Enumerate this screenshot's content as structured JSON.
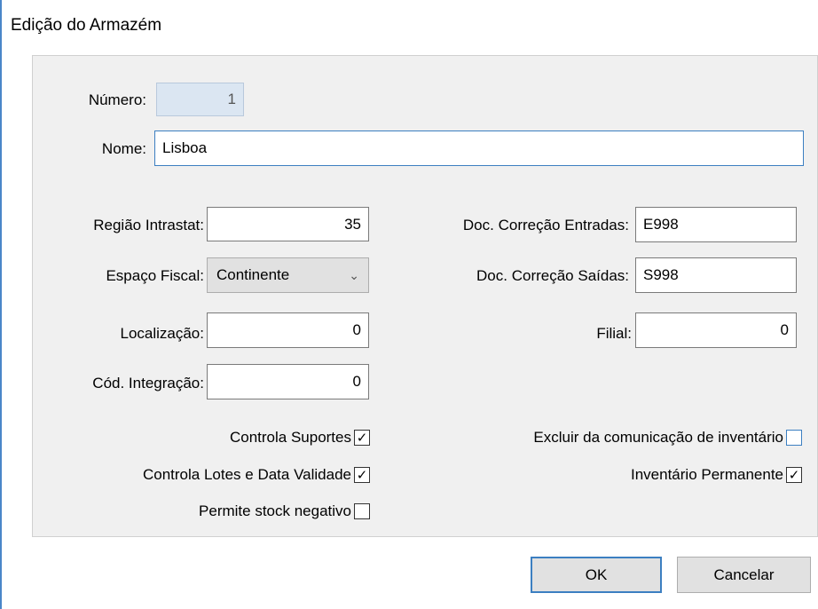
{
  "window": {
    "title": "Edição do Armazém"
  },
  "fields": {
    "numero": {
      "label": "Número:",
      "value": "1"
    },
    "nome": {
      "label": "Nome:",
      "value": "Lisboa"
    },
    "regiao_intrastat": {
      "label": "Região Intrastat:",
      "value": "35"
    },
    "espaco_fiscal": {
      "label": "Espaço Fiscal:",
      "value": "Continente"
    },
    "localizacao": {
      "label": "Localização:",
      "value": "0"
    },
    "cod_integracao": {
      "label": "Cód. Integração:",
      "value": "0"
    },
    "doc_correcao_entradas": {
      "label": "Doc. Correção  Entradas:",
      "value": "E998"
    },
    "doc_correcao_saidas": {
      "label": "Doc. Correção Saídas:",
      "value": "S998"
    },
    "filial": {
      "label": "Filial:",
      "value": "0"
    }
  },
  "checkboxes": {
    "controla_suportes": {
      "label": "Controla Suportes",
      "checked": true,
      "mark": "✓"
    },
    "controla_lotes": {
      "label": "Controla Lotes e Data Validade",
      "checked": true,
      "mark": "✓"
    },
    "permite_stock_negativo": {
      "label": "Permite stock negativo",
      "checked": false,
      "mark": ""
    },
    "excluir_comunicacao": {
      "label": "Excluir da comunicação de inventário",
      "checked": false,
      "mark": ""
    },
    "inventario_permanente": {
      "label": "Inventário Permanente",
      "checked": true,
      "mark": "✓"
    }
  },
  "buttons": {
    "ok": "OK",
    "cancel": "Cancelar"
  },
  "colors": {
    "accent": "#3c7fc1",
    "disabled_field": "#dbe6f2",
    "panel": "#f0f0f0"
  }
}
